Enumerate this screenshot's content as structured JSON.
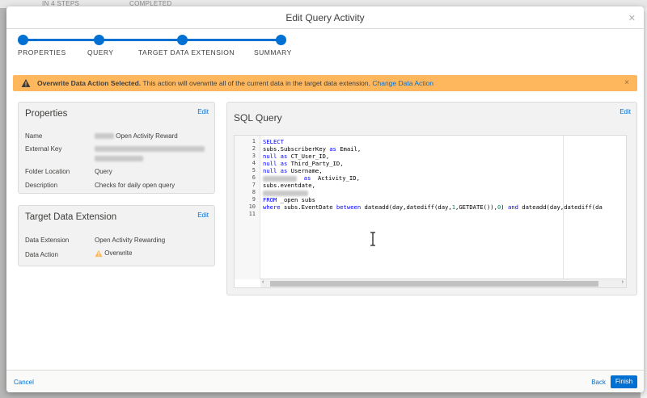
{
  "background": {
    "step_counter": "IN 4 STEPS",
    "status": "COMPLETED"
  },
  "modal": {
    "title": "Edit Query Activity"
  },
  "steps": [
    "PROPERTIES",
    "QUERY",
    "TARGET DATA EXTENSION",
    "SUMMARY"
  ],
  "alert": {
    "bold": "Overwrite Data Action Selected.",
    "message": " This action will overwrite all of the current data in the target data extension. ",
    "link": "Change Data Action",
    "close": "×"
  },
  "properties": {
    "title": "Properties",
    "edit": "Edit",
    "name_label": "Name",
    "name_value": "Open Activity Reward",
    "external_key_label": "External Key",
    "folder_label": "Folder Location",
    "folder_value": "Query",
    "description_label": "Description",
    "description_value": "Checks for daily open query"
  },
  "target": {
    "title": "Target Data Extension",
    "edit": "Edit",
    "de_label": "Data Extension",
    "de_value": "Open Activity Rewarding",
    "action_label": "Data Action",
    "action_value": "Overwrite"
  },
  "sql": {
    "title": "SQL Query",
    "edit": "Edit",
    "line_numbers": [
      "1",
      "2",
      "3",
      "4",
      "5",
      "6",
      "7",
      "8",
      "9",
      "10",
      "11"
    ],
    "lines": {
      "l1": "SELECT",
      "l2a": "subs.SubscriberKey ",
      "l2b": "as",
      "l2c": " Email,",
      "l3a": "null",
      "l3b": " as",
      "l3c": " CT_User_ID,",
      "l4a": "null",
      "l4b": " as",
      "l4c": " Third_Party_ID,",
      "l5a": "null",
      "l5b": " as",
      "l5c": " Username,",
      "l6b": "as",
      "l6c": "  Activity_ID,",
      "l7": "subs.eventdate,",
      "l9a": "FROM",
      "l9b": " _open subs",
      "l10a": "where",
      "l10b": " subs.EventDate ",
      "l10c": "between",
      "l10d": " dateadd(day,datediff(day,",
      "l10e": "1",
      "l10f": ",GETDATE()),",
      "l10g": "0",
      "l10h": ") ",
      "l10i": "and",
      "l10j": " dateadd(day,datediff(da"
    }
  },
  "footer": {
    "cancel": "Cancel",
    "back": "Back",
    "finish": "Finish"
  },
  "colors": {
    "brand": "#0070d2",
    "warning": "#ffb75d"
  }
}
